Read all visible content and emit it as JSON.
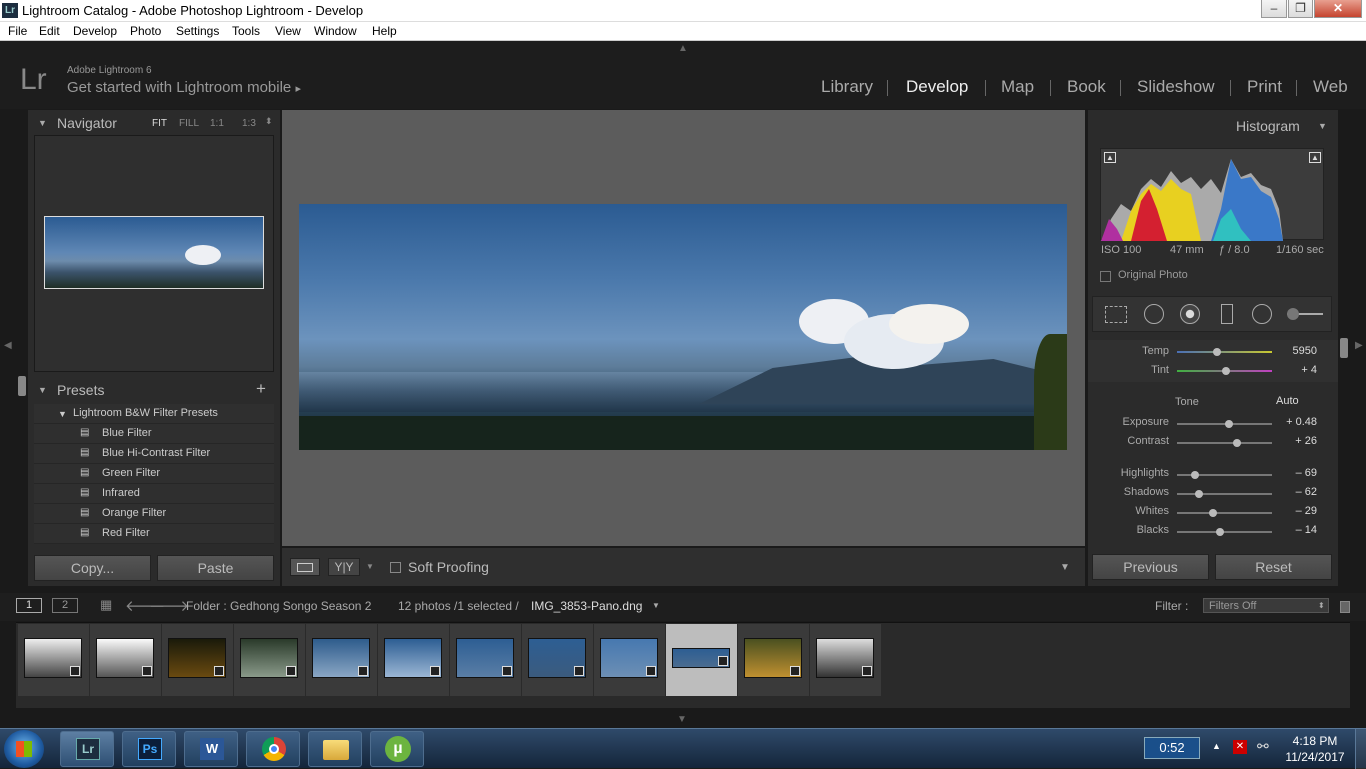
{
  "window": {
    "title": "Lightroom Catalog - Adobe Photoshop Lightroom - Develop",
    "app_icon": "Lr"
  },
  "menu": [
    "File",
    "Edit",
    "Develop",
    "Photo",
    "Settings",
    "Tools",
    "View",
    "Window",
    "Help"
  ],
  "identity": {
    "logo": "Lr",
    "product": "Adobe Lightroom 6",
    "mobile_prompt": "Get started with Lightroom mobile",
    "mobile_arrow": "▸"
  },
  "modules": [
    "Library",
    "Develop",
    "Map",
    "Book",
    "Slideshow",
    "Print",
    "Web"
  ],
  "active_module": "Develop",
  "navigator": {
    "title": "Navigator",
    "zoom_options": [
      "FIT",
      "FILL",
      "1:1",
      "1:3"
    ]
  },
  "presets": {
    "title": "Presets",
    "add": "+",
    "group": "Lightroom B&W Filter Presets",
    "items": [
      "Blue Filter",
      "Blue Hi-Contrast Filter",
      "Green Filter",
      "Infrared",
      "Orange Filter",
      "Red Filter"
    ]
  },
  "left_buttons": {
    "copy": "Copy...",
    "paste": "Paste"
  },
  "toolbar": {
    "soft_proofing": "Soft Proofing",
    "yy": "Y|Y"
  },
  "histogram": {
    "title": "Histogram",
    "iso": "ISO 100",
    "focal": "47 mm",
    "aperture": "ƒ / 8.0",
    "shutter": "1/160 sec",
    "original_photo": "Original Photo"
  },
  "basic": {
    "temp": {
      "label": "Temp",
      "value": "5950",
      "pos": 0.42
    },
    "tint": {
      "label": "Tint",
      "value": "+ 4",
      "pos": 0.52
    },
    "tone_label": "Tone",
    "auto_label": "Auto",
    "sliders": [
      {
        "label": "Exposure",
        "value": "+ 0.48",
        "pos": 0.55
      },
      {
        "label": "Contrast",
        "value": "+ 26",
        "pos": 0.63
      },
      {
        "label": "Highlights",
        "value": "– 69",
        "pos": 0.19
      },
      {
        "label": "Shadows",
        "value": "– 62",
        "pos": 0.23
      },
      {
        "label": "Whites",
        "value": "– 29",
        "pos": 0.38
      },
      {
        "label": "Blacks",
        "value": "– 14",
        "pos": 0.45
      }
    ]
  },
  "right_buttons": {
    "previous": "Previous",
    "reset": "Reset"
  },
  "filmbar": {
    "view1": "1",
    "view2": "2",
    "folder": "Folder : Gedhong Songo Season 2",
    "count": "12 photos /1 selected /",
    "filename": "IMG_3853-Pano.dng",
    "filter_label": "Filter :",
    "filter_value": "Filters Off"
  },
  "filmstrip": [
    {
      "colors": [
        "#eee",
        "#444"
      ]
    },
    {
      "colors": [
        "#fafafa",
        "#555"
      ]
    },
    {
      "colors": [
        "#1a1a0a",
        "#6a4a10"
      ]
    },
    {
      "colors": [
        "#2a3a2a",
        "#8a9a8a"
      ]
    },
    {
      "colors": [
        "#2e5c8c",
        "#8aa6c4"
      ]
    },
    {
      "colors": [
        "#2d5e93",
        "#9bb6d4"
      ]
    },
    {
      "colors": [
        "#2d5e93",
        "#5a7ea6"
      ]
    },
    {
      "colors": [
        "#2d5e93",
        "#3b5b7e"
      ]
    },
    {
      "colors": [
        "#4678b0",
        "#6d8fb4"
      ]
    },
    {
      "colors": [
        "#2d5e93",
        "#4b6c90"
      ]
    },
    {
      "colors": [
        "#4a5020",
        "#c09030"
      ]
    },
    {
      "colors": [
        "#ddd",
        "#333"
      ]
    }
  ],
  "taskbar": {
    "timer": "0:52",
    "time": "4:18 PM",
    "date": "11/24/2017"
  }
}
